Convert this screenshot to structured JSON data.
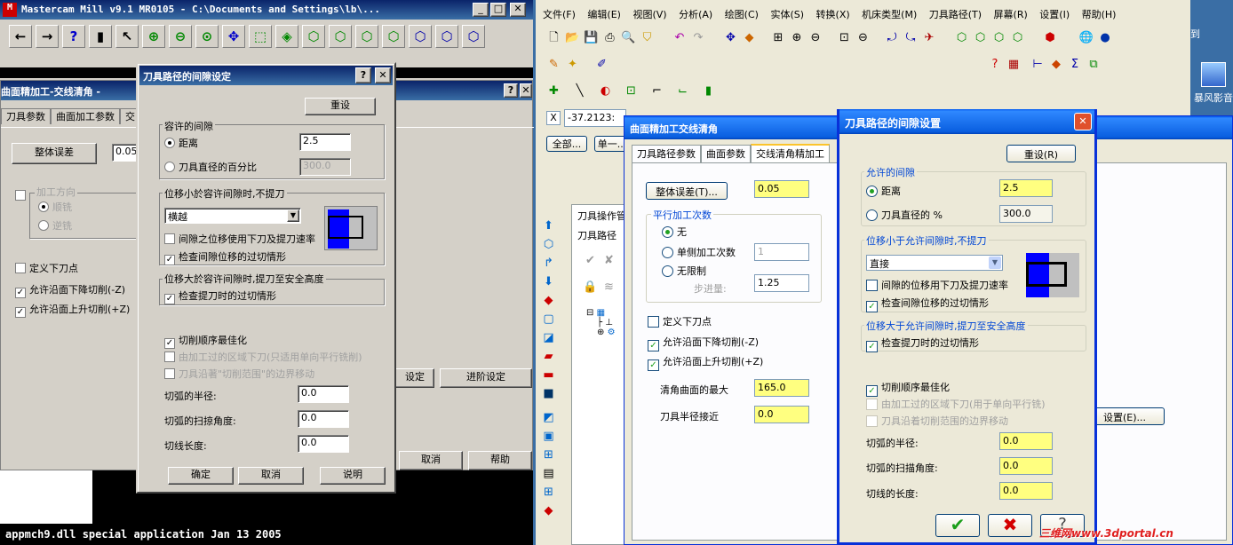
{
  "main_title": "Mastercam Mill v9.1 MR0105 - C:\\Documents and Settings\\lb\\...",
  "status_bar": "appmch9.dll special application Jan 13 2005",
  "menu": [
    "文件(F)",
    "编辑(E)",
    "视图(V)",
    "分析(A)",
    "绘图(C)",
    "实体(S)",
    "转换(X)",
    "机床类型(M)",
    "刀具路径(T)",
    "屏幕(R)",
    "设置(I)",
    "帮助(H)"
  ],
  "desktop_icon_label": "暴风影音",
  "desktop_top_label": "到",
  "coord_label": "X",
  "coord_value": "-37.2123:",
  "chip_all": "全部...",
  "chip_single": "单一...",
  "watermark": "三维网www.3dportal.cn",
  "left_parent": {
    "title": "曲面精加工-交线清角 - ",
    "tabs": [
      "刀具参数",
      "曲面加工参数",
      "交"
    ],
    "tolerance_btn": "整体误差",
    "tolerance_val": "0.05",
    "direction_group": "加工方向",
    "dir_cw": "顺铣",
    "dir_ccw": "逆铣",
    "define_plunge": "定义下刀点",
    "allow_down": "允许沿面下降切削(-Z)",
    "allow_up": "允许沿面上升切削(+Z)",
    "btn_setting": "设定",
    "btn_advanced": "进阶设定",
    "btn_cancel": "取消",
    "btn_help": "帮助"
  },
  "left_dialog": {
    "title": "刀具路径的间隙设定",
    "reset": "重设",
    "grp_gap": "容许的间隙",
    "opt_distance": "距离",
    "distance_val": "2.5",
    "opt_percent": "刀具直径的百分比",
    "percent_val": "300.0",
    "grp_small": "位移小於容许间隙时,不提刀",
    "method": "横越",
    "chk_gap_feed": "间隙之位移使用下刀及提刀速率",
    "chk_gouge": "检查间隙位移的过切情形",
    "grp_large": "位移大於容许间隙时,提刀至安全高度",
    "chk_retract_gouge": "检查提刀时的过切情形",
    "chk_optimize": "切削顺序最佳化",
    "chk_plunge_cut": "由加工过的区域下刀(只适用单向平行铣削)",
    "chk_follow": "刀具沿著\"切削范围\"的边界移动",
    "arc_radius_label": "切弧的半径:",
    "arc_radius": "0.0",
    "arc_sweep_label": "切弧的扫掠角度:",
    "arc_sweep": "0.0",
    "line_len_label": "切线长度:",
    "line_len": "0.0",
    "ok": "确定",
    "cancel": "取消",
    "help": "说明"
  },
  "right_parent": {
    "title": "曲面精加工交线清角",
    "tabs": [
      "刀具路径参数",
      "曲面参数",
      "交线清角精加工"
    ],
    "tolerance_btn": "整体误差(T)...",
    "tolerance_val": "0.05",
    "grp_passes": "平行加工次数",
    "opt_none": "无",
    "opt_single": "单侧加工次数",
    "single_val": "1",
    "opt_unlimited": "无限制",
    "stepover_label": "步进量:",
    "stepover_val": "1.25",
    "define_plunge": "定义下刀点",
    "allow_down": "允许沿面下降切削(-Z)",
    "allow_up": "允许沿面上升切削(+Z)",
    "max_angle_label": "清角曲面的最大",
    "max_angle": "165.0",
    "tool_radius_label": "刀具半径接近",
    "tool_radius": "0.0",
    "adv_btn": "设置(E)..."
  },
  "right_dialog": {
    "title": "刀具路径的间隙设置",
    "reset": "重设(R)",
    "grp_gap": "允许的间隙",
    "opt_distance": "距离",
    "distance_val": "2.5",
    "opt_percent": "刀具直径的 %",
    "percent_val": "300.0",
    "grp_small": "位移小于允许间隙时,不提刀",
    "method": "直接",
    "chk_gap_feed": "间隙的位移用下刀及提刀速率",
    "chk_gouge": "检查间隙位移的过切情形",
    "grp_large": "位移大于允许间隙时,提刀至安全高度",
    "chk_retract_gouge": "检查提刀时的过切情形",
    "chk_optimize": "切削顺序最佳化",
    "chk_plunge_cut": "由加工过的区域下刀(用于单向平行铣)",
    "chk_follow": "刀具沿着切削范围的边界移动",
    "arc_radius_label": "切弧的半径:",
    "arc_radius": "0.0",
    "arc_sweep_label": "切弧的扫描角度:",
    "arc_sweep": "0.0",
    "line_len_label": "切线的长度:",
    "line_len": "0.0"
  },
  "manager": {
    "tab1": "刀具操作管",
    "tab2": "刀具路径"
  }
}
